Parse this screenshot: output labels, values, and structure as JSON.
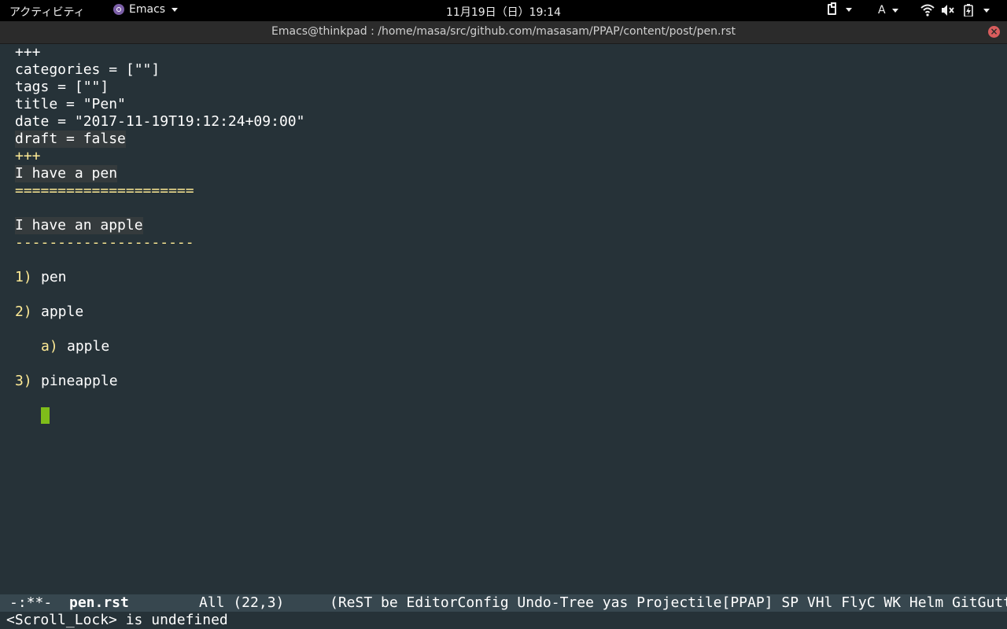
{
  "topbar": {
    "activities": "アクティビティ",
    "app_name": "Emacs",
    "clock": "11月19日（日）19:14",
    "input_method": "A"
  },
  "window": {
    "title": "Emacs@thinkpad : /home/masa/src/github.com/masasam/PPAP/content/post/pen.rst",
    "close_glyph": "×"
  },
  "buffer": {
    "lines": [
      "+++",
      "categories = [\"\"]",
      "tags = [\"\"]",
      "title = \"Pen\"",
      "date = \"2017-11-19T19:12:24+09:00\"",
      "draft = false",
      "+++",
      "I have a pen",
      "=====================",
      "I have an apple",
      "---------------------",
      "pen",
      "apple",
      "apple",
      "pineapple"
    ],
    "markers": [
      "1)",
      "2)",
      "a)",
      "3)"
    ]
  },
  "modeline": {
    "state": "-:**-",
    "buffer_name": "pen.rst",
    "position": "All (22,3)",
    "modes": "(ReST be EditorConfig Undo-Tree yas Projectile[PPAP] SP VHl FlyC WK Helm GitGutter"
  },
  "echo": "<Scroll_Lock> is undefined",
  "colors": {
    "background": "#263238",
    "modeline_bg": "#37474f",
    "cursor": "#7fbd1a",
    "heading_underline": "#ffeb95",
    "current_line": "#353b3d"
  }
}
